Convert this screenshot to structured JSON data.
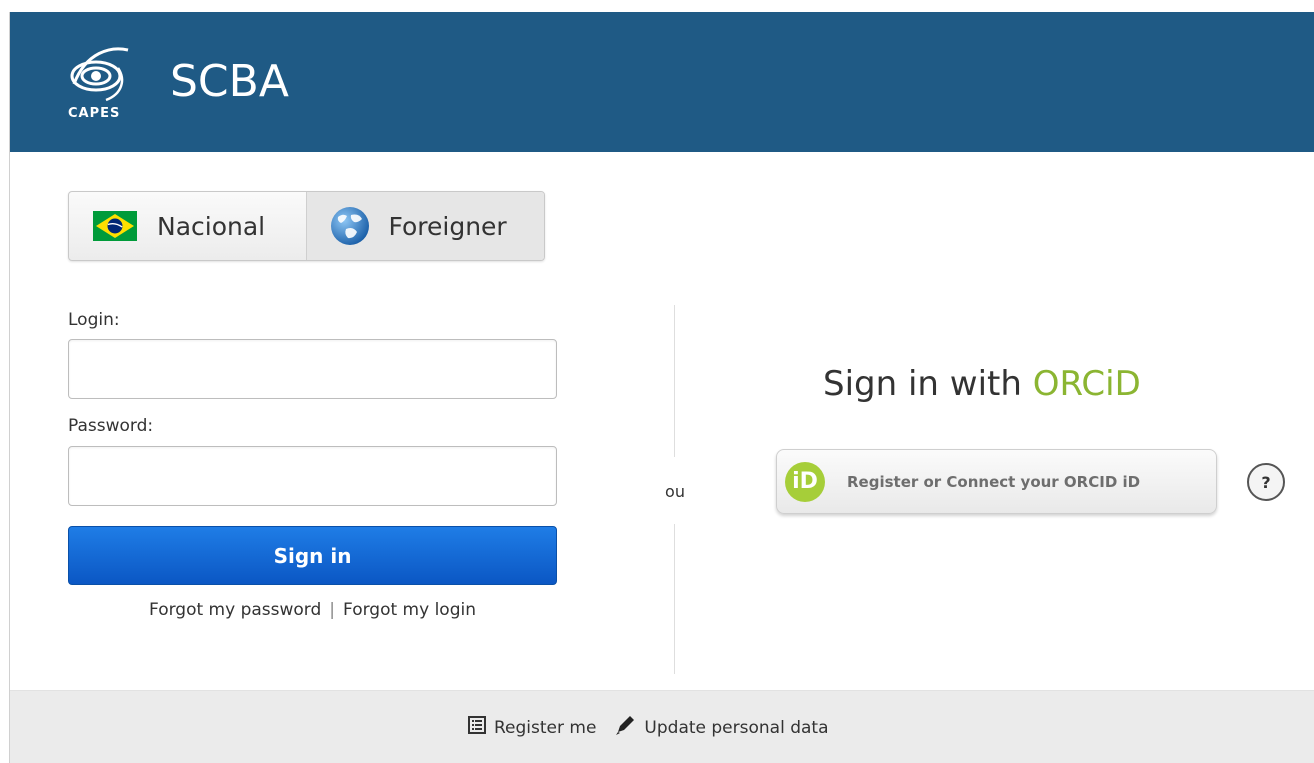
{
  "header": {
    "logo_text": "CAPES",
    "app_title": "SCBA",
    "background_color": "#1f5a85"
  },
  "login_type_tabs": [
    {
      "label": "Nacional",
      "icon": "brazil-flag-icon",
      "selected": false
    },
    {
      "label": "Foreigner",
      "icon": "globe-icon",
      "selected": true
    }
  ],
  "login_form": {
    "login_label": "Login:",
    "login_value": "",
    "password_label": "Password:",
    "password_value": "",
    "signin_label": "Sign in",
    "forgot_password": "Forgot my password",
    "separator": "|",
    "forgot_login": "Forgot my login"
  },
  "divider": {
    "text": "ou"
  },
  "orcid": {
    "title_prefix": "Sign in with",
    "title_brand": "ORCiD",
    "brand_color": "#a6ce39",
    "logo_text": "iD",
    "button_label": "Register or Connect your ORCID iD",
    "help_label": "?"
  },
  "footer": {
    "register": {
      "label": "Register me",
      "icon": "list-icon"
    },
    "update": {
      "label": "Update personal data",
      "icon": "pencil-icon"
    }
  }
}
